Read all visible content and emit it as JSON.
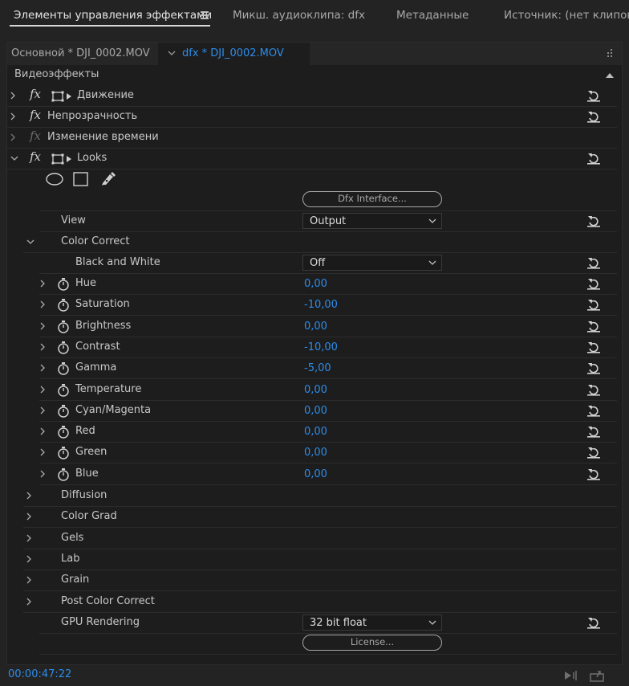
{
  "tabs": [
    {
      "label": "Элементы управления эффектами",
      "active": true
    },
    {
      "label": "Микш. аудиоклипа: dfx",
      "active": false
    },
    {
      "label": "Метаданные",
      "active": false
    },
    {
      "label": "Источник: (нет клипов)",
      "active": false
    }
  ],
  "sequence": {
    "main": "Основной * DJI_0002.MOV",
    "clip": "dfx * DJI_0002.MOV"
  },
  "section_title": "Видеоэффекты",
  "effects": {
    "motion": "Движение",
    "opacity": "Непрозрачность",
    "time_remap": "Изменение времени",
    "looks": "Looks"
  },
  "looks": {
    "dfx_interface_label": "Dfx Interface...",
    "view": {
      "label": "View",
      "value": "Output"
    },
    "color_correct": {
      "label": "Color Correct"
    },
    "black_and_white": {
      "label": "Black and White",
      "value": "Off"
    },
    "params": [
      {
        "label": "Hue",
        "value": "0,00"
      },
      {
        "label": "Saturation",
        "value": "-10,00"
      },
      {
        "label": "Brightness",
        "value": "0,00"
      },
      {
        "label": "Contrast",
        "value": "-10,00"
      },
      {
        "label": "Gamma",
        "value": "-5,00"
      },
      {
        "label": "Temperature",
        "value": "0,00"
      },
      {
        "label": "Cyan/Magenta",
        "value": "0,00"
      },
      {
        "label": "Red",
        "value": "0,00"
      },
      {
        "label": "Green",
        "value": "0,00"
      },
      {
        "label": "Blue",
        "value": "0,00"
      }
    ],
    "groups": [
      "Diffusion",
      "Color Grad",
      "Gels",
      "Lab",
      "Grain",
      "Post Color Correct"
    ],
    "gpu": {
      "label": "GPU Rendering",
      "value": "32 bit float"
    },
    "license_label": "License..."
  },
  "status": {
    "timecode": "00:00:47:22"
  },
  "colors": {
    "accent": "#2d8ceb",
    "background": "#1d1d1d"
  }
}
